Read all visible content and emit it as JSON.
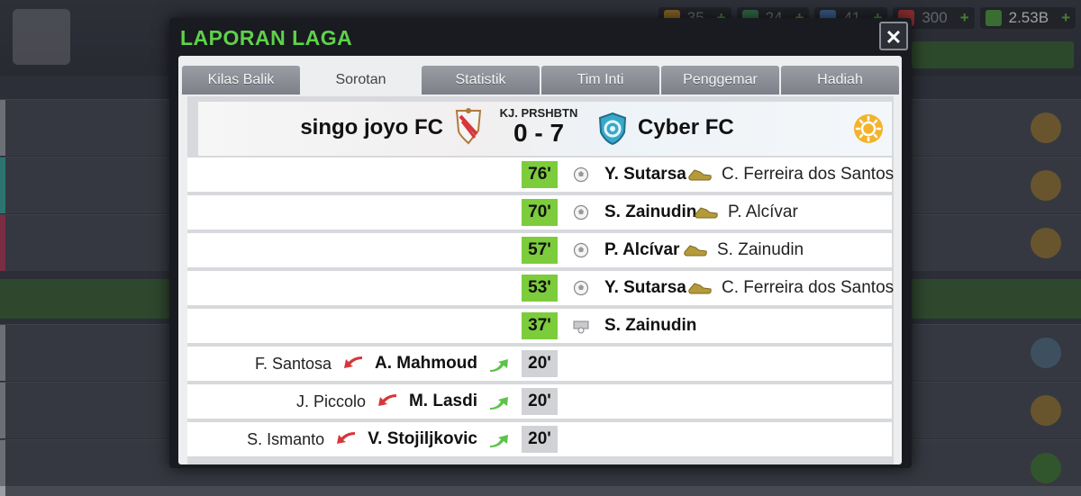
{
  "background": {
    "resources": [
      {
        "icon": "mixed-badge-icon",
        "value": "35",
        "color": "#c58a2c"
      },
      {
        "icon": "green-token-icon",
        "value": "24",
        "color": "#3c8f5a"
      },
      {
        "icon": "blue-boost-icon",
        "value": "41",
        "color": "#4a78b8"
      },
      {
        "icon": "red-card-icon",
        "value": "300",
        "color": "#c9393a"
      },
      {
        "icon": "cash-icon",
        "value": "2.53B",
        "color": "#4f9b3c"
      }
    ]
  },
  "modal": {
    "title": "LAPORAN LAGA",
    "close_label": "✕",
    "tabs": [
      {
        "label": "Kilas Balik",
        "active": false
      },
      {
        "label": "Sorotan",
        "active": true
      },
      {
        "label": "Statistik",
        "active": false
      },
      {
        "label": "Tim Inti",
        "active": false
      },
      {
        "label": "Penggemar",
        "active": false
      },
      {
        "label": "Hadiah",
        "active": false
      }
    ],
    "match": {
      "home_team": "singo joyo FC",
      "away_team": "Cyber FC",
      "competition_label": "KJ. PRSHBTN",
      "score": "0 - 7",
      "weather_icon": "sun-icon"
    },
    "events": [
      {
        "minute": "76'",
        "type": "goal",
        "scorer": "Y. Sutarsa",
        "assist": "C. Ferreira dos Santos"
      },
      {
        "minute": "70'",
        "type": "goal",
        "scorer": "S. Zainudin",
        "assist": "P. Alcívar"
      },
      {
        "minute": "57'",
        "type": "goal",
        "scorer": "P. Alcívar",
        "assist": "S. Zainudin"
      },
      {
        "minute": "53'",
        "type": "goal",
        "scorer": "Y. Sutarsa",
        "assist": "C. Ferreira dos Santos"
      },
      {
        "minute": "37'",
        "type": "goal",
        "scorer": "S. Zainudin",
        "assist": ""
      },
      {
        "minute": "20'",
        "type": "substitution",
        "player_out": "F. Santosa",
        "player_in": "A. Mahmoud"
      },
      {
        "minute": "20'",
        "type": "substitution",
        "player_out": "J. Piccolo",
        "player_in": "M. Lasdi"
      },
      {
        "minute": "20'",
        "type": "substitution",
        "player_out": "S. Ismanto",
        "player_in": "V. Stojiljkovic"
      }
    ]
  }
}
